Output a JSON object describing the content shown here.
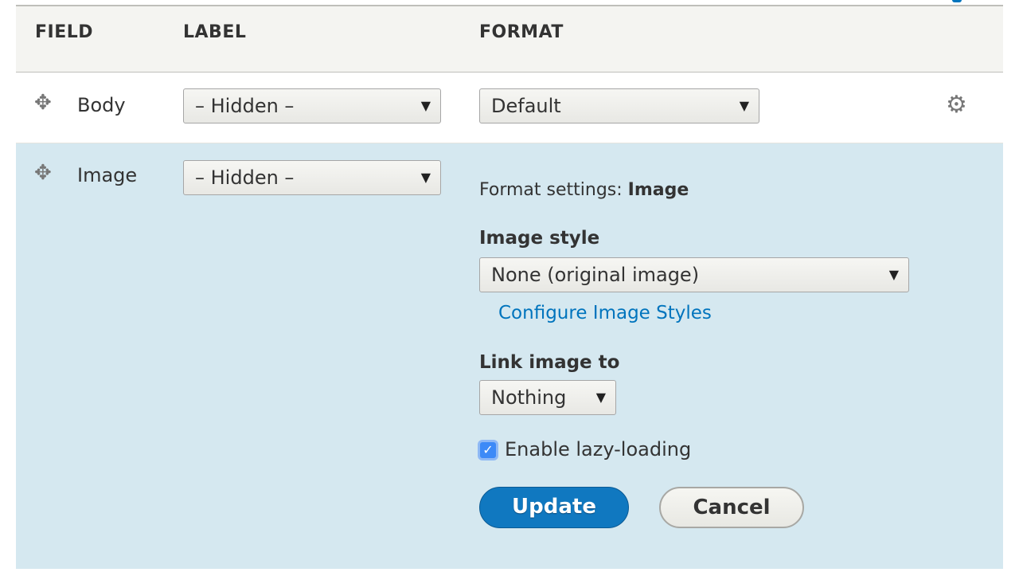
{
  "table": {
    "headers": [
      "FIELD",
      "LABEL",
      "FORMAT"
    ],
    "rows": [
      {
        "field": "Body",
        "label": "– Hidden –",
        "format": "Default"
      },
      {
        "field": "Image",
        "label": "– Hidden –"
      }
    ]
  },
  "settings": {
    "title_prefix": "Format settings: ",
    "title_field": "Image",
    "image_style_label": "Image style",
    "image_style_value": "None (original image)",
    "configure_link": "Configure Image Styles",
    "link_image_label": "Link image to",
    "link_image_value": "Nothing",
    "lazy_label": "Enable lazy-loading",
    "lazy_checked": true,
    "update": "Update",
    "cancel": "Cancel"
  },
  "icons": {
    "drag": "move-icon",
    "settings": "gear-icon",
    "dropdown": "triangle-down",
    "check": "checkmark"
  },
  "colors": {
    "accent": "#0074bd",
    "row_highlight": "#d5e8f0",
    "header_bg": "#f4f4f1",
    "button_primary": "#1078c0"
  }
}
